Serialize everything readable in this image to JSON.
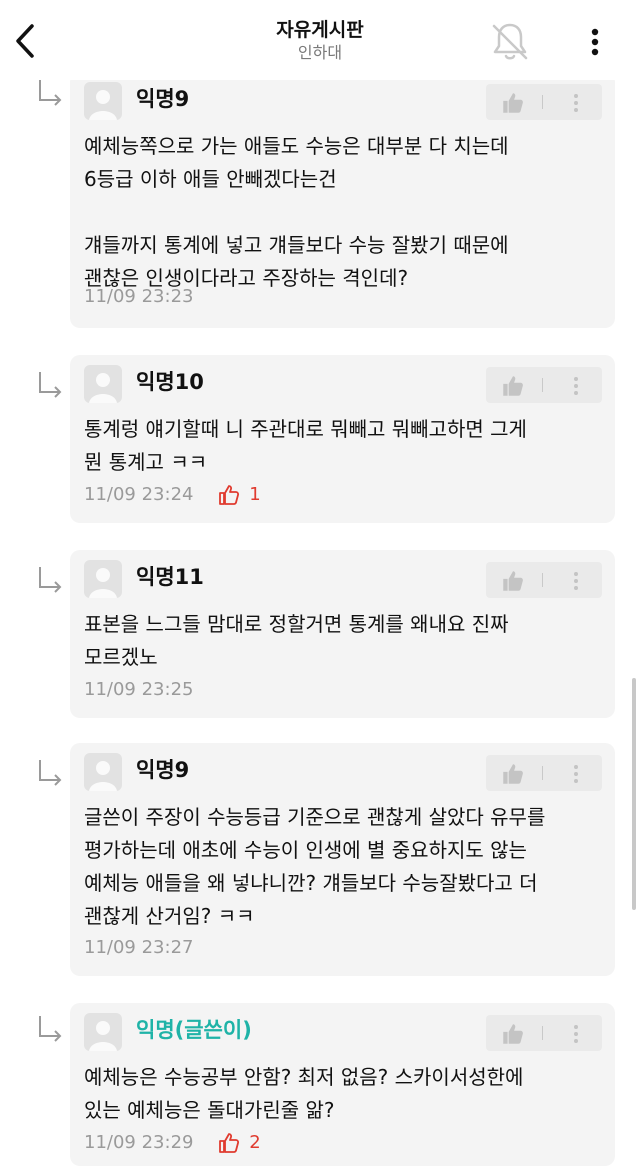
{
  "header": {
    "title": "자유게시판",
    "subtitle": "인하대",
    "back_icon": "chevron-left-icon",
    "bell_icon": "bell-off-icon",
    "more_icon": "more-vertical-icon"
  },
  "colors": {
    "op_name": "#1fb3a7",
    "vote": "#e03b2f",
    "card_bg": "#f4f4f4"
  },
  "comments": [
    {
      "author": "익명9",
      "is_op": false,
      "text": "예체능쪽으로 가는 애들도 수능은 대부분 다 치는데\n6등급 이하 애들 안빼겠다는건\n\n걔들까지 통계에 넣고 걔들보다 수능 잘봤기 때문에\n괜찮은 인생이다라고 주장하는 격인데?",
      "time": "11/09 23:23",
      "votes": ""
    },
    {
      "author": "익명10",
      "is_op": false,
      "text": "통계렁 얘기할때 니 주관대로 뭐빼고 뭐빼고하면 그게\n뭔 통계고 ㅋㅋ",
      "time": "11/09 23:24",
      "votes": "1"
    },
    {
      "author": "익명11",
      "is_op": false,
      "text": "표본을 느그들 맘대로 정할거면 통계를 왜내요 진짜\n모르겠노",
      "time": "11/09 23:25",
      "votes": ""
    },
    {
      "author": "익명9",
      "is_op": false,
      "text": "글쓴이 주장이 수능등급 기준으로 괜찮게 살았다 유무를\n평가하는데 애초에 수능이 인생에 별 중요하지도 않는\n예체능 애들을 왜 넣냐니깐? 걔들보다 수능잘봤다고 더\n괜찮게 산거임? ㅋㅋ",
      "time": "11/09 23:27",
      "votes": ""
    },
    {
      "author": "익명(글쓴이)",
      "is_op": true,
      "text": "예체능은 수능공부 안함? 최저 없음? 스카이서성한에\n있는 예체능은 돌대가린줄 앎?",
      "time": "11/09 23:29",
      "votes": "2"
    }
  ]
}
